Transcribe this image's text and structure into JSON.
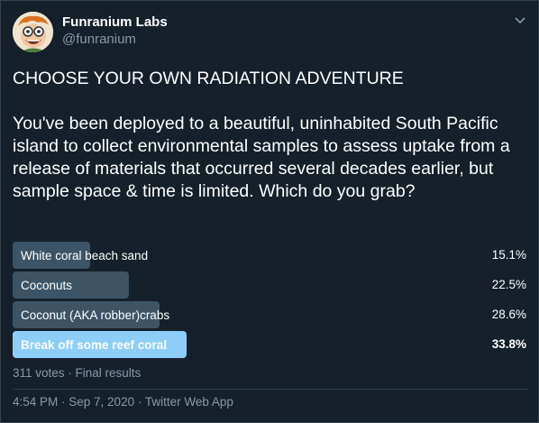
{
  "author": {
    "name": "Funranium Labs",
    "handle": "@funranium"
  },
  "tweet": {
    "title": "CHOOSE YOUR OWN RADIATION ADVENTURE",
    "body": "You've been deployed to a beautiful, uninhabited South Pacific island to collect environmental samples to assess uptake from a release of materials that occurred several decades earlier, but sample space & time is limited. Which do you grab?"
  },
  "poll": {
    "options": [
      {
        "label": "White coral beach sand",
        "percent_text": "15.1%",
        "percent": 15.1,
        "winner": false
      },
      {
        "label": "Coconuts",
        "percent_text": "22.5%",
        "percent": 22.5,
        "winner": false
      },
      {
        "label": "Coconut (AKA robber)crabs",
        "percent_text": "28.6%",
        "percent": 28.6,
        "winner": false
      },
      {
        "label": "Break off some reef coral",
        "percent_text": "33.8%",
        "percent": 33.8,
        "winner": true
      }
    ],
    "summary": "311 votes · Final results"
  },
  "meta": {
    "timestamp": "4:54 PM · Sep 7, 2020 · Twitter Web App"
  },
  "colors": {
    "background": "#15202b",
    "bar": "#3d5466",
    "winner_bar": "#8ecdf8",
    "secondary_text": "#8899a6"
  },
  "icons": {
    "caret": "chevron-down-icon",
    "avatar": "cartoon-avatar"
  }
}
